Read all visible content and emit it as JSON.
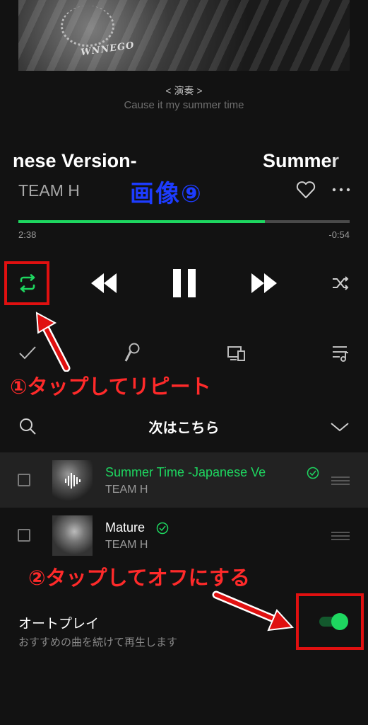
{
  "album": {
    "art_text": "WNNEGO"
  },
  "lyrics": {
    "label": "< 演奏 >",
    "line": "Cause it my summer time"
  },
  "now_playing": {
    "title_left_fragment": "nese Version-",
    "title_right_fragment": "Summer",
    "artist": "TEAM H",
    "progress_fraction": 0.745,
    "time_elapsed": "2:38",
    "time_remaining": "-0:54"
  },
  "annotations": {
    "image_label": "画像⑨",
    "step1": "①タップしてリピート",
    "step2": "②タップしてオフにする"
  },
  "queue": {
    "title": "次はこちら",
    "tracks": [
      {
        "title": "Summer Time -Japanese Ve",
        "artist": "TEAM H",
        "playing": true
      },
      {
        "title": "Mature",
        "artist": "TEAM H",
        "playing": false
      }
    ]
  },
  "autoplay": {
    "label": "オートプレイ",
    "description": "おすすめの曲を続けて再生します",
    "enabled": true
  },
  "icons": {
    "repeat": "repeat-icon",
    "previous": "previous-icon",
    "pause": "pause-icon",
    "next": "next-icon",
    "shuffle": "shuffle-icon",
    "check": "check-icon",
    "mic": "microphone-icon",
    "devices": "devices-icon",
    "playlist": "playlist-icon",
    "search": "search-icon",
    "collapse": "chevron-down-icon",
    "heart": "heart-icon",
    "more": "more-icon"
  },
  "colors": {
    "accent": "#1ed760",
    "annotation": "#ff2a2a",
    "image_label": "#1d3cff",
    "background": "#121212"
  }
}
